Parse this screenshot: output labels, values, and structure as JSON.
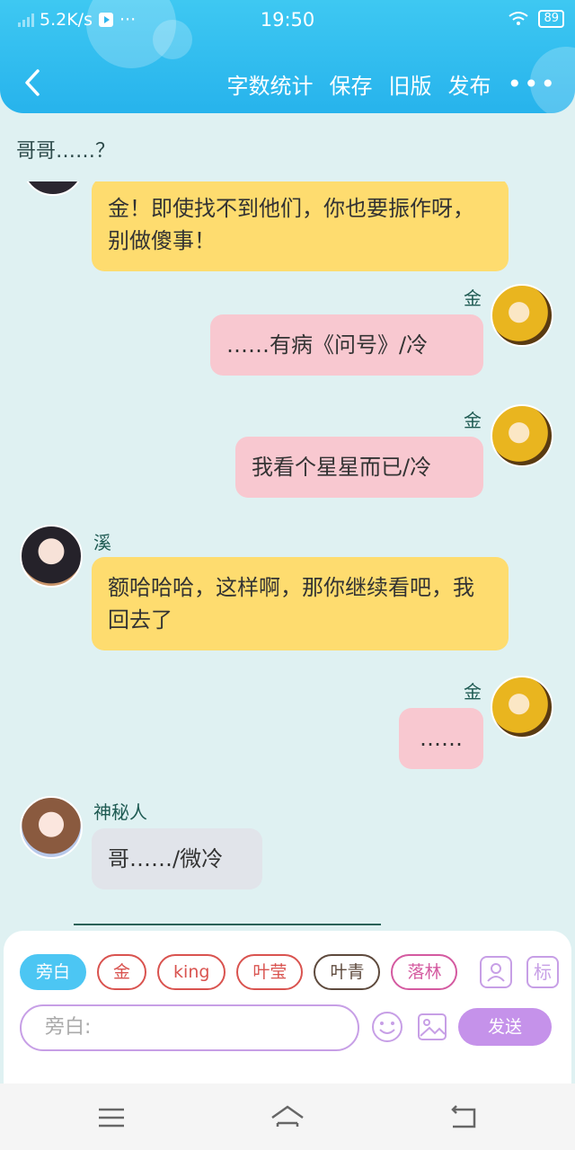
{
  "status": {
    "speed": "5.2K/s",
    "dots": "···",
    "time": "19:50",
    "battery": "89"
  },
  "toolbar": {
    "actions": [
      "字数统计",
      "保存",
      "旧版",
      "发布"
    ],
    "more": "•••"
  },
  "topic": "哥哥……？",
  "messages": [
    {
      "text": "金！即使找不到他们，你也要振作呀，别做傻事！"
    },
    {
      "name": "金",
      "text": "……有病《问号》/冷"
    },
    {
      "name": "金",
      "text": "我看个星星而已/冷"
    },
    {
      "name": "溪",
      "text": "额哈哈哈，这样啊，那你继续看吧，我回去了"
    },
    {
      "name": "金",
      "text": "……"
    },
    {
      "name": "神秘人",
      "text": "哥……/微冷"
    }
  ],
  "characters": [
    "旁白",
    "金",
    "king",
    "叶莹",
    "叶青",
    "落林"
  ],
  "side_icons": {
    "mark": "标"
  },
  "input": {
    "placeholder": "旁白:"
  },
  "send_label": "发送",
  "colors": {
    "header": "#27b3ec",
    "yellow_bubble": "#fedc6f",
    "pink_bubble": "#f8c8d0",
    "grey_bubble": "#e1e4ea",
    "send": "#c592ea"
  }
}
